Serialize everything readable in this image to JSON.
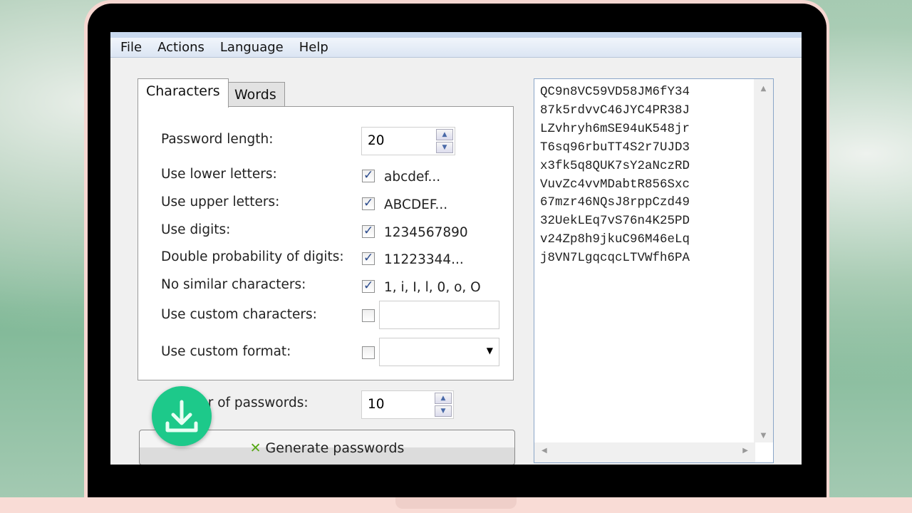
{
  "menu": [
    "File",
    "Actions",
    "Language",
    "Help"
  ],
  "tabs": [
    {
      "label": "Characters",
      "active": true
    },
    {
      "label": "Words",
      "active": false
    }
  ],
  "options": {
    "length_label": "Password length:",
    "length_value": "20",
    "checks": [
      {
        "label": "Use lower letters:",
        "checked": true,
        "sample": "abcdef..."
      },
      {
        "label": "Use upper letters:",
        "checked": true,
        "sample": "ABCDEF..."
      },
      {
        "label": "Use digits:",
        "checked": true,
        "sample": "1234567890"
      },
      {
        "label": "Double probability of digits:",
        "checked": true,
        "sample": "11223344..."
      },
      {
        "label": "No similar characters:",
        "checked": true,
        "sample": "1, i, I, l, 0, o, O"
      }
    ],
    "custom_chars_label": "Use custom characters:",
    "custom_chars_checked": false,
    "custom_chars_value": "",
    "custom_format_label": "Use custom format:",
    "custom_format_checked": false,
    "custom_format_value": ""
  },
  "count_label": "Number of passwords:",
  "count_value": "10",
  "generate_label": "Generate passwords",
  "passwords": [
    "QC9n8VC59VD58JM6fY34",
    "87k5rdvvC46JYC4PR38J",
    "LZvhryh6mSE94uK548jr",
    "T6sq96rbuTT4S2r7UJD3",
    "x3fk5q8QUK7sY2aNczRD",
    "VuvZc4vvMDabtR856Sxc",
    "67mzr46NQsJ8rppCzd49",
    "32UekLEq7vS76n4K25PD",
    "v24Zp8h9jkuC96M46eLq",
    "j8VN7LgqcqcLTVWfh6PA"
  ],
  "colors": {
    "download_badge": "#1dc98a",
    "frame": "#f6d7d1"
  }
}
